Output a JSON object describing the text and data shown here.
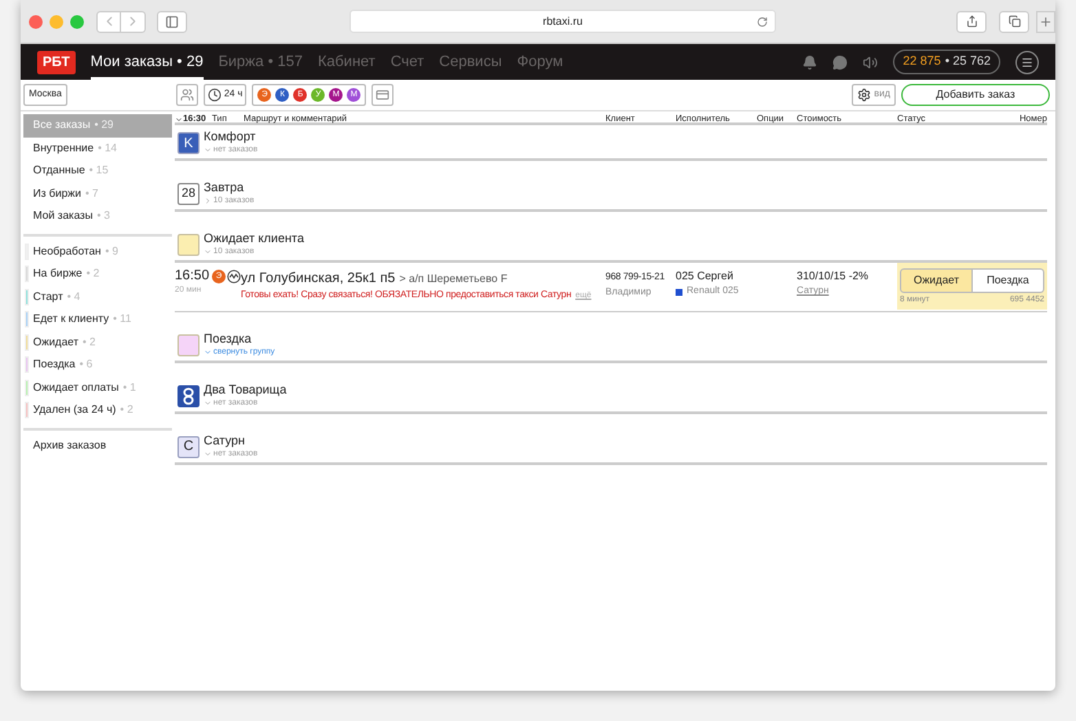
{
  "browser": {
    "url": "rbtaxi.ru"
  },
  "nav": {
    "logo": "РБТ",
    "items": [
      {
        "label": "Мои заказы • 29",
        "selected": true
      },
      {
        "label": "Биржа • 157",
        "selected": false
      },
      {
        "label": "Кабинет",
        "selected": false
      },
      {
        "label": "Счет",
        "selected": false
      },
      {
        "label": "Сервисы",
        "selected": false
      },
      {
        "label": "Форум",
        "selected": false
      }
    ],
    "balance": {
      "primary": "22 875",
      "secondary": "• 25 762"
    }
  },
  "toolbar": {
    "city": "Москва",
    "period": "24 ч",
    "tariffs": [
      {
        "label": "Э",
        "color": "#e8641e"
      },
      {
        "label": "К",
        "color": "#2f5fc4"
      },
      {
        "label": "Б",
        "color": "#e0322a"
      },
      {
        "label": "У",
        "color": "#6cb82a"
      },
      {
        "label": "М",
        "color": "#a5168c"
      },
      {
        "label": "М",
        "color": "#a050d8"
      }
    ],
    "view_button": "вид",
    "add_button": "Добавить заказ"
  },
  "sidebar": {
    "sections": [
      {
        "items": [
          {
            "label": "Все заказы",
            "count": "• 29",
            "selected": true
          },
          {
            "label": "Внутренние",
            "count": "• 14",
            "selected": false
          },
          {
            "label": "Отданные",
            "count": "• 15",
            "selected": false
          },
          {
            "label": "Из биржи",
            "count": "• 7",
            "selected": false
          },
          {
            "label": "Мой заказы",
            "count": "• 3",
            "selected": false
          }
        ]
      },
      {
        "items": [
          {
            "label": "Необработан",
            "count": "• 9",
            "selected": false,
            "color": "#f0f0f0"
          },
          {
            "label": "На бирже",
            "count": "• 2",
            "selected": false,
            "color": "#d8d8d8"
          },
          {
            "label": "Старт",
            "count": "• 4",
            "selected": false,
            "color": "#8fe0dc"
          },
          {
            "label": "Едет к клиенту",
            "count": "• 11",
            "selected": false,
            "color": "#a8d0f5"
          },
          {
            "label": "Ожидает",
            "count": "• 2",
            "selected": false,
            "color": "#f0dc98"
          },
          {
            "label": "Поездка",
            "count": "• 6",
            "selected": false,
            "color": "#e8c4f0"
          },
          {
            "label": "Ожидает оплаты",
            "count": "• 1",
            "selected": false,
            "color": "#b8f0b0"
          },
          {
            "label": "Удален (за 24 ч)",
            "count": "• 2",
            "selected": false,
            "color": "#f5c0c0"
          }
        ]
      },
      {
        "items": [
          {
            "label": "Архив заказов",
            "selected": false
          }
        ]
      }
    ]
  },
  "table": {
    "columns": [
      "16:30",
      "Тип",
      "Маршрут и комментарий",
      "Клиент",
      "Исполнитель",
      "Опции",
      "Стоимость",
      "Статус",
      "Номер"
    ],
    "groups": [
      {
        "title": "Комфорт",
        "subtitle": "нет заказов",
        "expanded": true,
        "icon": {
          "kind": "letter",
          "text": "K",
          "color": "#3a5fb8"
        }
      },
      {
        "title": "Завтра",
        "subtitle": "10 заказов",
        "expanded": false,
        "icon": {
          "kind": "calendar",
          "text": "28"
        }
      },
      {
        "title": "Ожидает клиента",
        "subtitle": "10 заказов",
        "expanded": true,
        "icon": {
          "kind": "swatch",
          "color": "#fbeeb0"
        },
        "orders": [
          {
            "time": "16:50",
            "elapsed": "20 мин",
            "tariff": {
              "label": "Э",
              "color": "#e8641e"
            },
            "address": "ул Голубинская, 25к1 п5",
            "destination": "> а/п Шереметьево F",
            "comment": "Готовы ехать! Сразу связаться! ОБЯЗАТЕЛЬНО предоставиться такси Сатурн",
            "more": "ещё",
            "phone": "968 799-15-21",
            "client": "Владимир",
            "driver": "025 Сергей",
            "car": {
              "label": "Renault 025",
              "color": "#1f4fd0"
            },
            "price": "310/10/15 -2%",
            "company": "Сатурн",
            "statuses": [
              {
                "label": "Ожидает",
                "selected": true
              },
              {
                "label": "Поездка",
                "selected": false
              }
            ],
            "wait": "8 минут",
            "number": "695 4452"
          }
        ]
      },
      {
        "title": "Поездка",
        "subtitle": "свернуть группу",
        "expanded": true,
        "link": true,
        "icon": {
          "kind": "swatch",
          "color": "#f5d4f8"
        }
      },
      {
        "title": "Два Товарища",
        "subtitle": "нет заказов",
        "expanded": true,
        "icon": {
          "kind": "logo",
          "color": "#2a4fa8"
        }
      },
      {
        "title": "Сатурн",
        "subtitle": "нет заказов",
        "expanded": true,
        "icon": {
          "kind": "letter",
          "text": "C",
          "color": "#e4e4f8"
        }
      }
    ]
  }
}
